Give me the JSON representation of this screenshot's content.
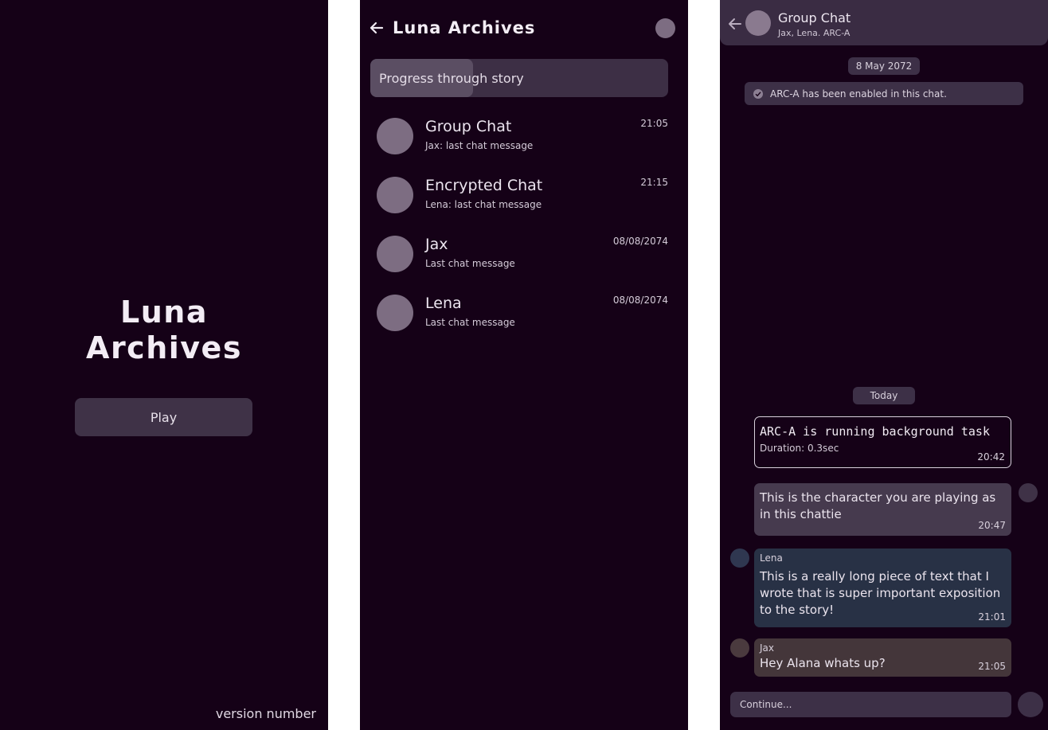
{
  "title_screen": {
    "title_line1": "Luna",
    "title_line2": "Archives",
    "play_label": "Play",
    "version_label": "version number"
  },
  "chat_list_screen": {
    "title": "Luna Archives",
    "progress_label": "Progress through story",
    "progress_fraction": 0.345,
    "chats": [
      {
        "name": "Group Chat",
        "preview": "Jax: last chat message",
        "time": "21:05"
      },
      {
        "name": "Encrypted Chat",
        "preview": "Lena: last chat message",
        "time": "21:15"
      },
      {
        "name": "Jax",
        "preview": "Last chat message",
        "time": "08/08/2074"
      },
      {
        "name": "Lena",
        "preview": "Last chat message",
        "time": "08/08/2074"
      }
    ]
  },
  "conversation_screen": {
    "title": "Group Chat",
    "subtitle": "Jax, Lena. ARC-A",
    "date_chip_1": "8 May 2072",
    "system_message": "ARC-A has been enabled in this chat.",
    "date_chip_2": "Today",
    "task_message": {
      "text": "ARC-A is running background task",
      "duration": "Duration: 0.3sec",
      "time": "20:42"
    },
    "my_message": {
      "text": "This is the character you are playing as in this chattie",
      "time": "20:47"
    },
    "lena_message": {
      "sender": "Lena",
      "text": "This is a really long piece of text that I wrote that is super important exposition to the story!",
      "time": "21:01"
    },
    "jax_message": {
      "sender": "Jax",
      "text": "Hey Alana whats up?",
      "time": "21:05"
    },
    "composer_placeholder": "Continue..."
  },
  "colors": {
    "background": "#150117",
    "surface": "#3d3047",
    "avatar": "#7d6d82",
    "lena_bubble": "#283145",
    "jax_bubble": "#44363a"
  }
}
